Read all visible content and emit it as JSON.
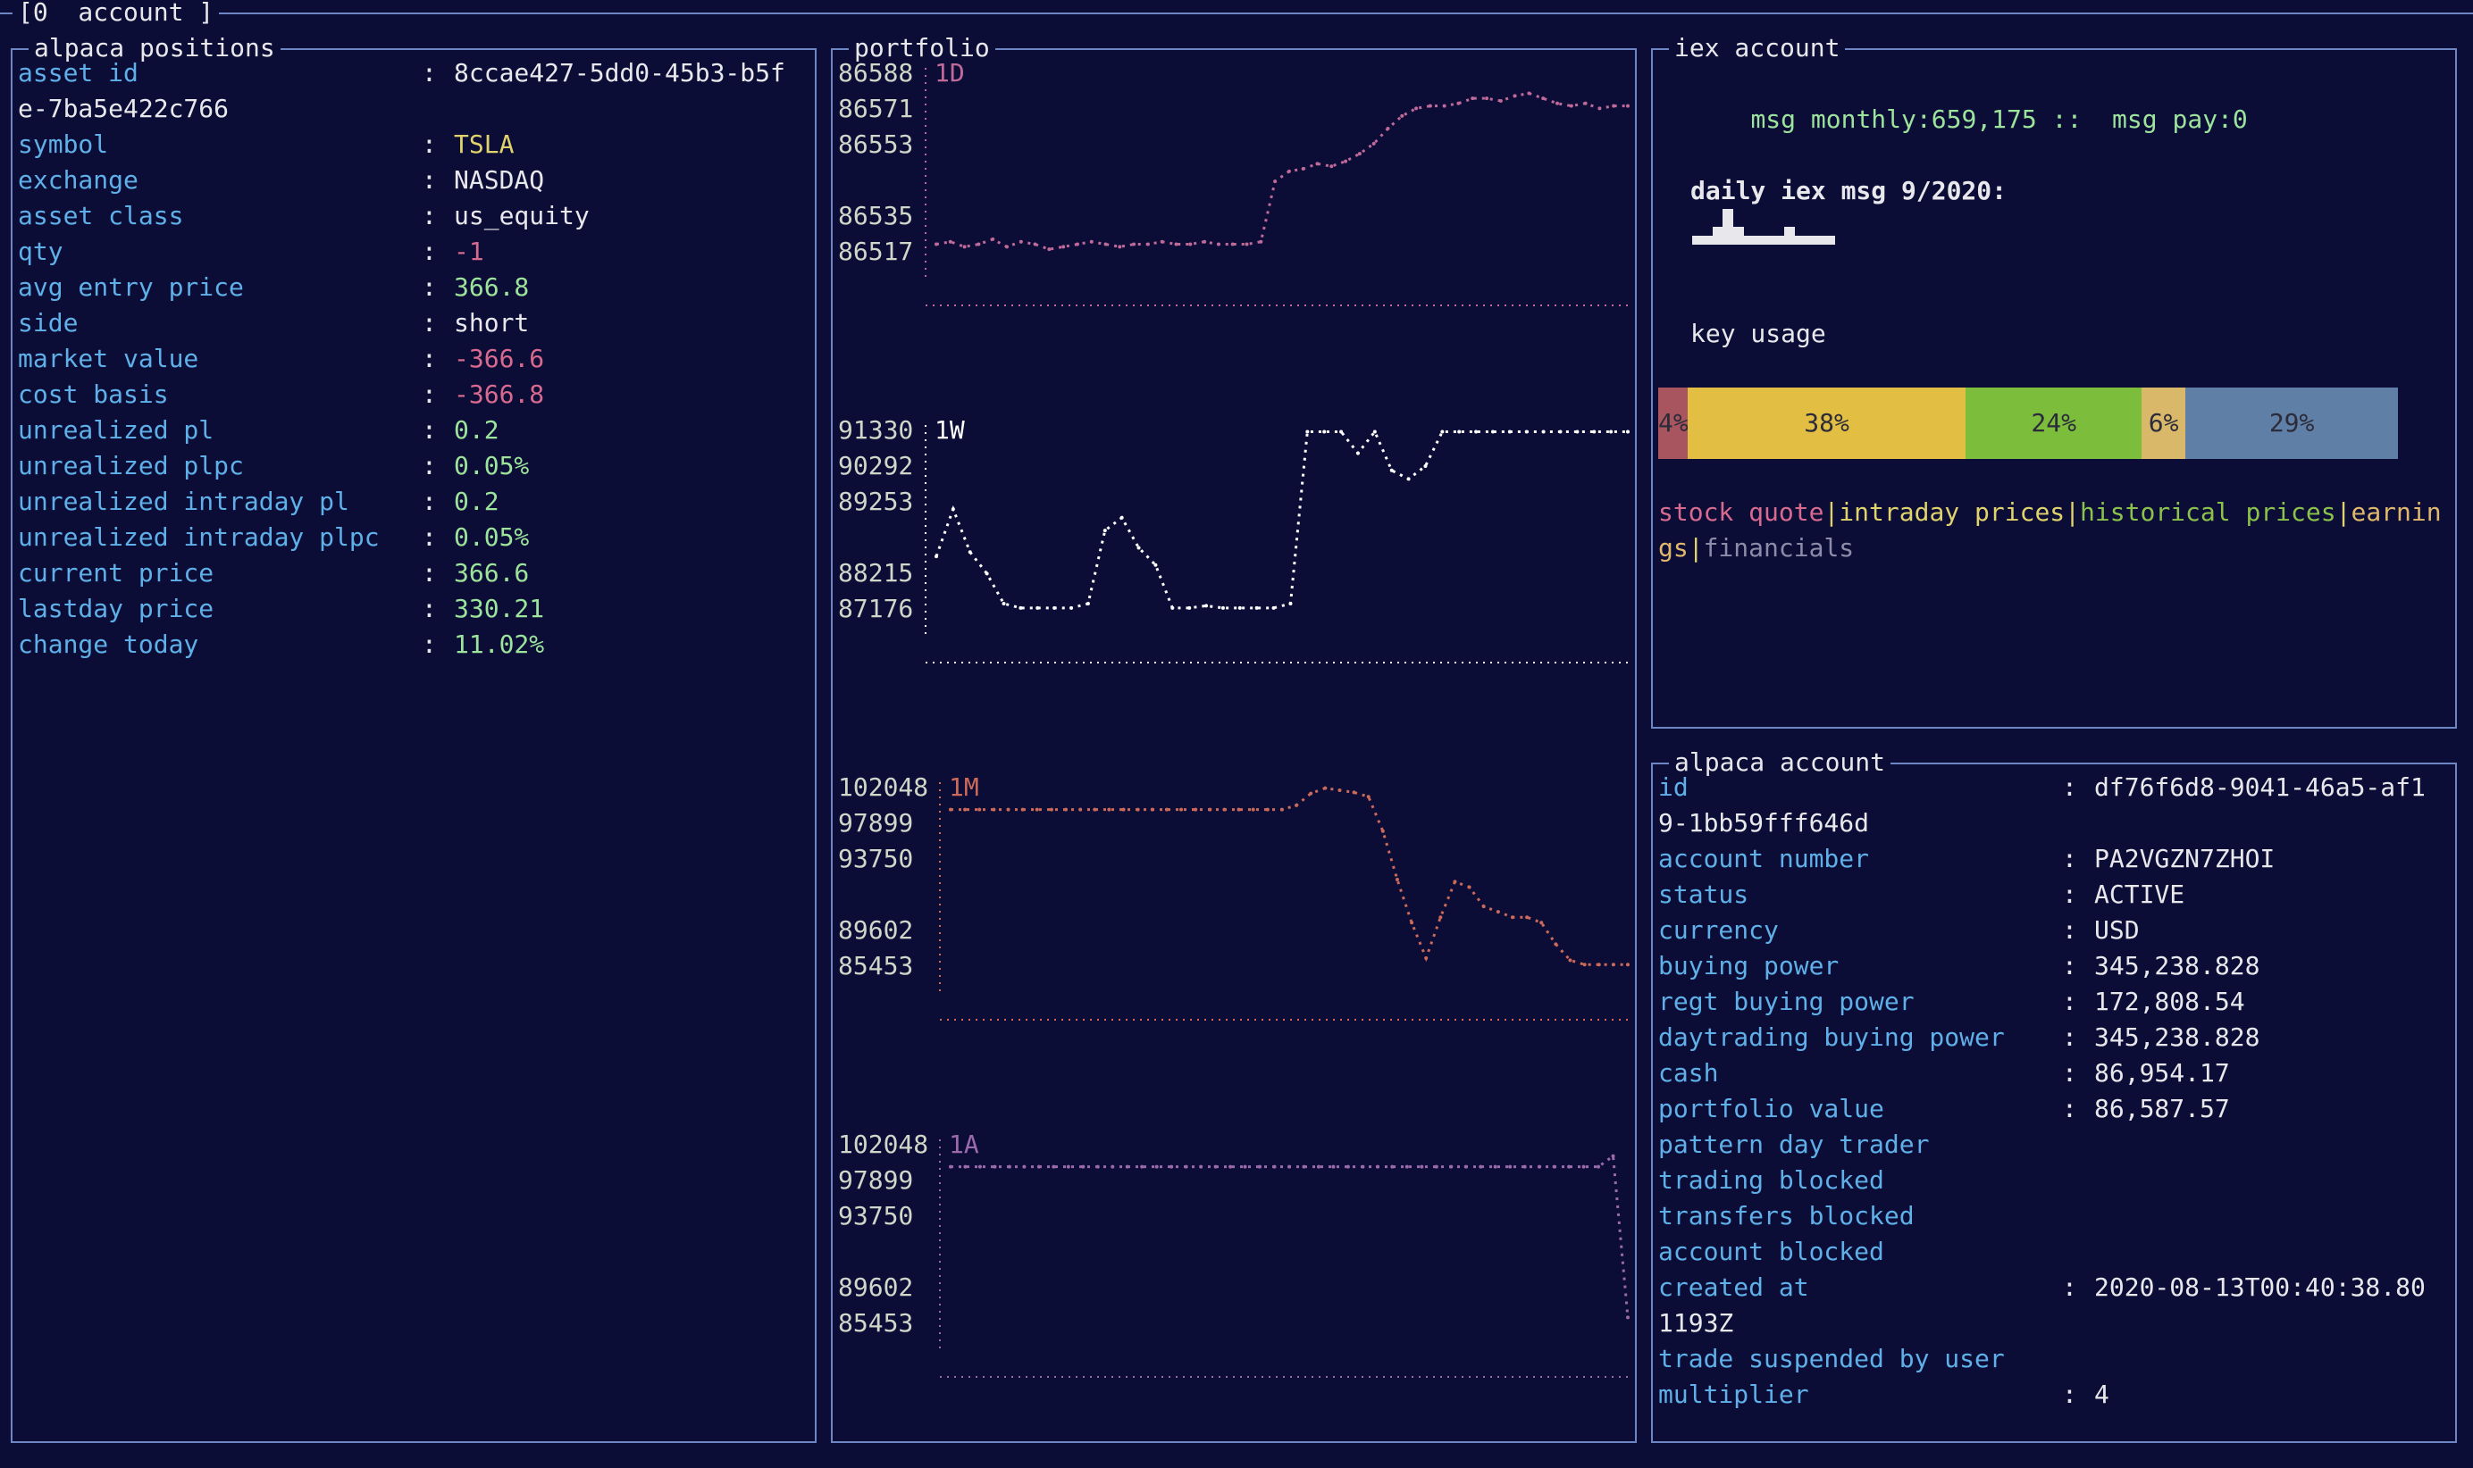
{
  "top_bar": {
    "label": "[0  account ]"
  },
  "positions": {
    "title": "alpaca positions",
    "rows": [
      {
        "key": "asset id",
        "value": "8ccae427-5dd0-45b3-b5f",
        "cls": "v"
      },
      {
        "key": "",
        "value": "",
        "cls": "v",
        "cont": "e-7ba5e422c766"
      },
      {
        "key": "symbol",
        "value": "TSLA",
        "cls": "yellow"
      },
      {
        "key": "exchange",
        "value": "NASDAQ",
        "cls": "v"
      },
      {
        "key": "asset class",
        "value": "us_equity",
        "cls": "v"
      },
      {
        "key": "qty",
        "value": "-1",
        "cls": "red"
      },
      {
        "key": "avg entry price",
        "value": "366.8",
        "cls": "green"
      },
      {
        "key": "side",
        "value": "short",
        "cls": "v"
      },
      {
        "key": "market value",
        "value": "-366.6",
        "cls": "red"
      },
      {
        "key": "cost basis",
        "value": "-366.8",
        "cls": "red"
      },
      {
        "key": "unrealized pl",
        "value": "0.2",
        "cls": "green"
      },
      {
        "key": "unrealized plpc",
        "value": "0.05%",
        "cls": "green"
      },
      {
        "key": "unrealized intraday pl",
        "value": "0.2",
        "cls": "green"
      },
      {
        "key": "unrealized intraday plpc",
        "value": "0.05%",
        "cls": "green"
      },
      {
        "key": "current price",
        "value": "366.6",
        "cls": "green"
      },
      {
        "key": "lastday price",
        "value": "330.21",
        "cls": "green"
      },
      {
        "key": "change today",
        "value": "11.02%",
        "cls": "green"
      }
    ]
  },
  "portfolio": {
    "title": "portfolio",
    "charts": [
      {
        "period": "1D",
        "color": "#c06a9a",
        "ticks": [
          "86588",
          "86571",
          "86553",
          "86535",
          "86517"
        ],
        "values": [
          86520,
          86521,
          86519,
          86520,
          86522,
          86519,
          86521,
          86520,
          86518,
          86519,
          86520,
          86521,
          86520,
          86519,
          86520,
          86520,
          86521,
          86520,
          86520,
          86521,
          86520,
          86520,
          86520,
          86521,
          86545,
          86549,
          86550,
          86552,
          86551,
          86553,
          86556,
          86560,
          86566,
          86571,
          86574,
          86575,
          86575,
          86576,
          86578,
          86578,
          86577,
          86579,
          86580,
          86578,
          86576,
          86575,
          86576,
          86574,
          86575,
          86575
        ]
      },
      {
        "period": "1W",
        "color": "#ffffff",
        "ticks": [
          "91330",
          "90292",
          "89253",
          "88215",
          "87176"
        ],
        "values": [
          88400,
          89500,
          88500,
          88000,
          87300,
          87200,
          87200,
          87200,
          87200,
          87300,
          89000,
          89300,
          88600,
          88200,
          87200,
          87200,
          87250,
          87200,
          87200,
          87200,
          87200,
          87300,
          91300,
          91300,
          91300,
          90800,
          91300,
          90400,
          90200,
          90500,
          91300,
          91300,
          91300,
          91300,
          91300,
          91300,
          91300,
          91300,
          91300,
          91300,
          91300,
          91300
        ]
      },
      {
        "period": "1M",
        "color": "#cc6a5a",
        "ticks": [
          "102048",
          "97899",
          "93750",
          "89602",
          "85453"
        ],
        "values": [
          100000,
          100000,
          100000,
          100000,
          100000,
          100000,
          100000,
          100000,
          100000,
          100000,
          100000,
          100000,
          100000,
          100000,
          100000,
          100000,
          100000,
          100000,
          100000,
          100000,
          100000,
          100000,
          100000,
          100000,
          100400,
          101500,
          102000,
          101800,
          101600,
          101200,
          98000,
          93500,
          89500,
          86200,
          90000,
          93300,
          92800,
          91000,
          90500,
          90000,
          90000,
          89500,
          87500,
          86000,
          85600,
          85600,
          85600,
          85600
        ]
      },
      {
        "period": "1A",
        "color": "#9a6aaa",
        "ticks": [
          "102048",
          "97899",
          "93750",
          "89602",
          "85453"
        ],
        "values": [
          100000,
          100000,
          100000,
          100000,
          100000,
          100000,
          100000,
          100000,
          100000,
          100000,
          100000,
          100000,
          100000,
          100000,
          100000,
          100000,
          100000,
          100000,
          100000,
          100000,
          100000,
          100000,
          100000,
          100000,
          100000,
          100000,
          100000,
          100000,
          100000,
          100000,
          100000,
          100000,
          100000,
          100000,
          100000,
          100000,
          100000,
          100000,
          100000,
          100000,
          100000,
          100000,
          100000,
          100000,
          100000,
          101000,
          86000
        ]
      }
    ]
  },
  "iex": {
    "title": "iex account",
    "msg_monthly_label": "msg monthly:",
    "msg_monthly": "659,175",
    "sep": "::",
    "msg_pay_label": "msg pay:",
    "msg_pay": "0",
    "daily_title": "daily iex msg 9/2020:",
    "sparkline": [
      1,
      1,
      2,
      4,
      2,
      1,
      1,
      1,
      1,
      2,
      1,
      1,
      1,
      1
    ],
    "key_usage_title": "key usage",
    "usage": [
      {
        "label": "4%",
        "value": 4,
        "color": "#a8555f"
      },
      {
        "label": "38%",
        "value": 38,
        "color": "#e2bf43"
      },
      {
        "label": "24%",
        "value": 24,
        "color": "#7cbd3c"
      },
      {
        "label": "6%",
        "value": 6,
        "color": "#d9b86a"
      },
      {
        "label": "29%",
        "value": 29,
        "color": "#5f7fa6"
      }
    ],
    "legend": [
      {
        "label": "stock quote",
        "color": "#d76a8e"
      },
      {
        "label": "intraday prices",
        "color": "#e1d36b"
      },
      {
        "label": "historical prices",
        "color": "#8bc34a"
      },
      {
        "label": "earnings",
        "color": "#e1b86b"
      },
      {
        "label": "financials",
        "color": "#8c8ca8"
      }
    ]
  },
  "account": {
    "title": "alpaca account",
    "rows": [
      {
        "key": "id",
        "value": "df76f6d8-9041-46a5-af1"
      },
      {
        "key": "",
        "value": "",
        "cont": "9-1bb59fff646d"
      },
      {
        "key": "account number",
        "value": "PA2VGZN7ZHOI"
      },
      {
        "key": "status",
        "value": "ACTIVE"
      },
      {
        "key": "currency",
        "value": "USD"
      },
      {
        "key": "buying power",
        "value": "345,238.828"
      },
      {
        "key": "regt buying power",
        "value": "172,808.54"
      },
      {
        "key": "daytrading buying power",
        "value": "345,238.828"
      },
      {
        "key": "cash",
        "value": "86,954.17"
      },
      {
        "key": "portfolio value",
        "value": "86,587.57"
      },
      {
        "key": "pattern day trader",
        "value": ""
      },
      {
        "key": "trading blocked",
        "value": ""
      },
      {
        "key": "transfers blocked",
        "value": ""
      },
      {
        "key": "account blocked",
        "value": ""
      },
      {
        "key": "created at",
        "value": "2020-08-13T00:40:38.80"
      },
      {
        "key": "",
        "value": "",
        "cont": "1193Z"
      },
      {
        "key": "trade suspended by user",
        "value": ""
      },
      {
        "key": "multiplier",
        "value": "4"
      }
    ]
  }
}
